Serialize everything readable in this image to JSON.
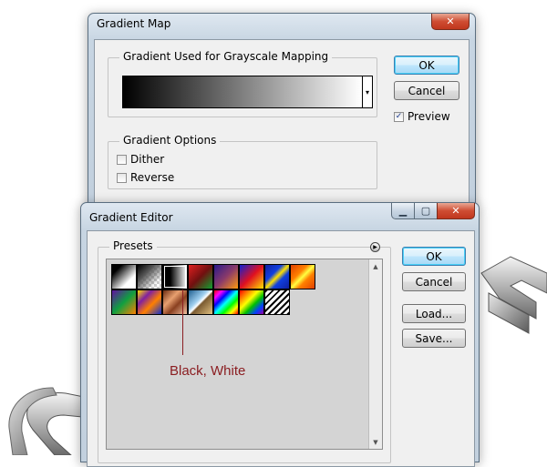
{
  "gradient_map": {
    "title": "Gradient Map",
    "close_icon": "close-icon",
    "gradient_group_label": "Gradient Used for Grayscale Mapping",
    "gradient": {
      "from": "#000000",
      "to": "#ffffff"
    },
    "options_group_label": "Gradient Options",
    "dither_label": "Dither",
    "dither_checked": false,
    "reverse_label": "Reverse",
    "reverse_checked": false,
    "ok_label": "OK",
    "cancel_label": "Cancel",
    "preview_label": "Preview",
    "preview_checked": true
  },
  "gradient_editor": {
    "title": "Gradient Editor",
    "presets_label": "Presets",
    "ok_label": "OK",
    "cancel_label": "Cancel",
    "load_label": "Load...",
    "save_label": "Save...",
    "presets": [
      "foreground-to-background",
      "foreground-to-transparent",
      "black-white",
      "red-green",
      "violet-orange",
      "blue-red-yellow",
      "blue-yellow-blue",
      "orange-yellow-orange",
      "violet-green-orange",
      "yellow-violet-orange-blue",
      "copper",
      "chrome",
      "spectrum",
      "transparent-rainbow",
      "transparent-stripes"
    ],
    "selected_preset": "Black, White"
  },
  "callout": {
    "text": "Black, White",
    "color": "#8b1e22"
  }
}
